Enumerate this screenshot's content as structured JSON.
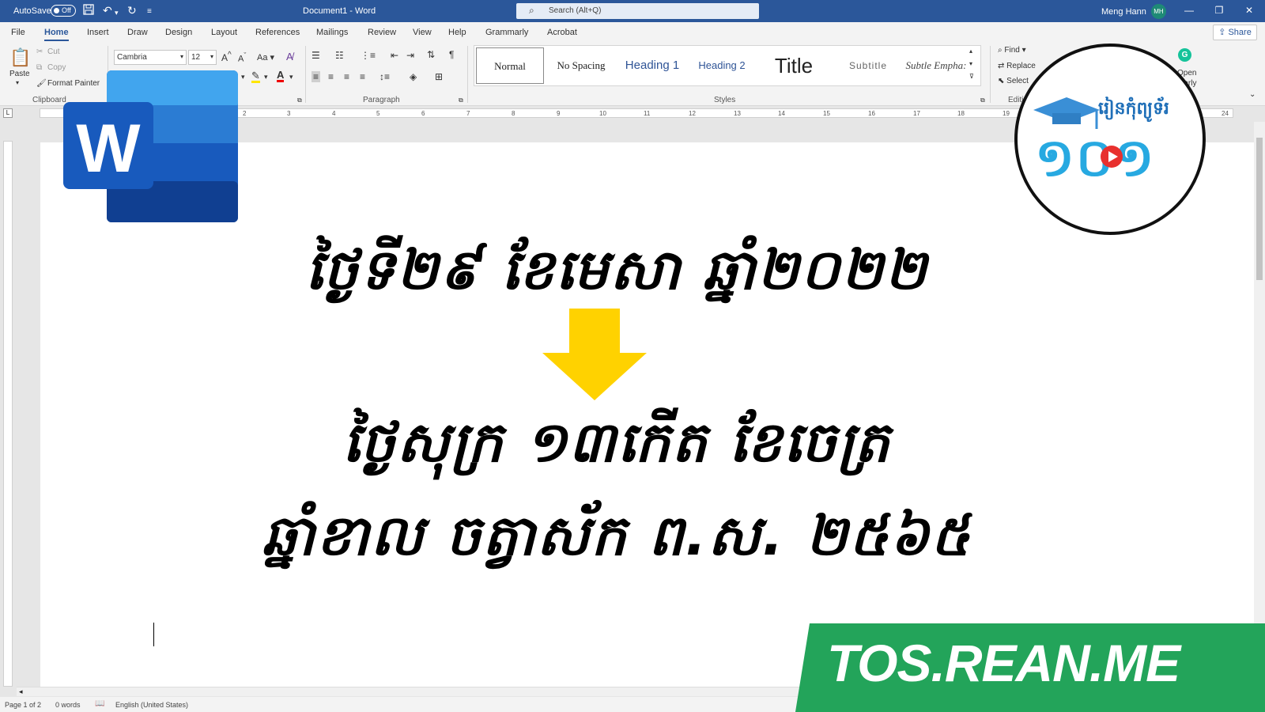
{
  "titlebar": {
    "autosave_label": "AutoSave",
    "autosave_state": "Off",
    "document_title": "Document1  -  Word",
    "search_placeholder": "Search (Alt+Q)",
    "user_name": "Meng Hann",
    "user_initials": "MH",
    "bar_color": "#2b579a"
  },
  "menu": {
    "tabs": [
      "File",
      "Home",
      "Insert",
      "Draw",
      "Design",
      "Layout",
      "References",
      "Mailings",
      "Review",
      "View",
      "Help",
      "Grammarly",
      "Acrobat"
    ],
    "active_tab": "Home",
    "share_label": "Share"
  },
  "ribbon": {
    "clipboard": {
      "paste": "Paste",
      "cut": "Cut",
      "copy": "Copy",
      "format_painter": "Format Painter",
      "group_label": "Clipboard"
    },
    "font": {
      "font_name": "Cambria",
      "font_size": "12",
      "change_case": "Aa"
    },
    "paragraph": {
      "group_label": "Paragraph"
    },
    "styles": {
      "items": [
        "Normal",
        "No Spacing",
        "Heading 1",
        "Heading 2",
        "Title",
        "Subtitle",
        "Subtle Empha:"
      ],
      "group_label": "Styles"
    },
    "editing": {
      "find": "Find",
      "replace": "Replace",
      "select": "Select",
      "group_label": "Editi"
    },
    "grammarly": {
      "open": "Open",
      "label": "...arly"
    }
  },
  "ruler": {
    "corner": "L",
    "ticks": [
      "2",
      "3",
      "4",
      "5",
      "6",
      "7",
      "8",
      "9",
      "10",
      "11",
      "12",
      "13",
      "14",
      "15",
      "16",
      "17",
      "18",
      "19",
      "24"
    ]
  },
  "document": {
    "line1": "ថ្ងៃទី២៩ ខែមេសា ឆ្នាំ២០២២",
    "line2": "ថ្ងៃសុក្រ ១៣កើត ខែចេត្រ",
    "line3": "ឆ្នាំខាល ចត្វាស័ក ព.ស. ២៥៦៥",
    "arrow_color": "#ffd200"
  },
  "status": {
    "page": "Page 1 of 2",
    "words": "0 words",
    "language": "English (United States)"
  },
  "overlays": {
    "word_logo_letter": "W",
    "channel_text": "រៀនកុំព្យូទ័រ",
    "channel_number": "១០១",
    "banner_text": "TOS.REAN.ME",
    "banner_color": "#23a45a"
  }
}
